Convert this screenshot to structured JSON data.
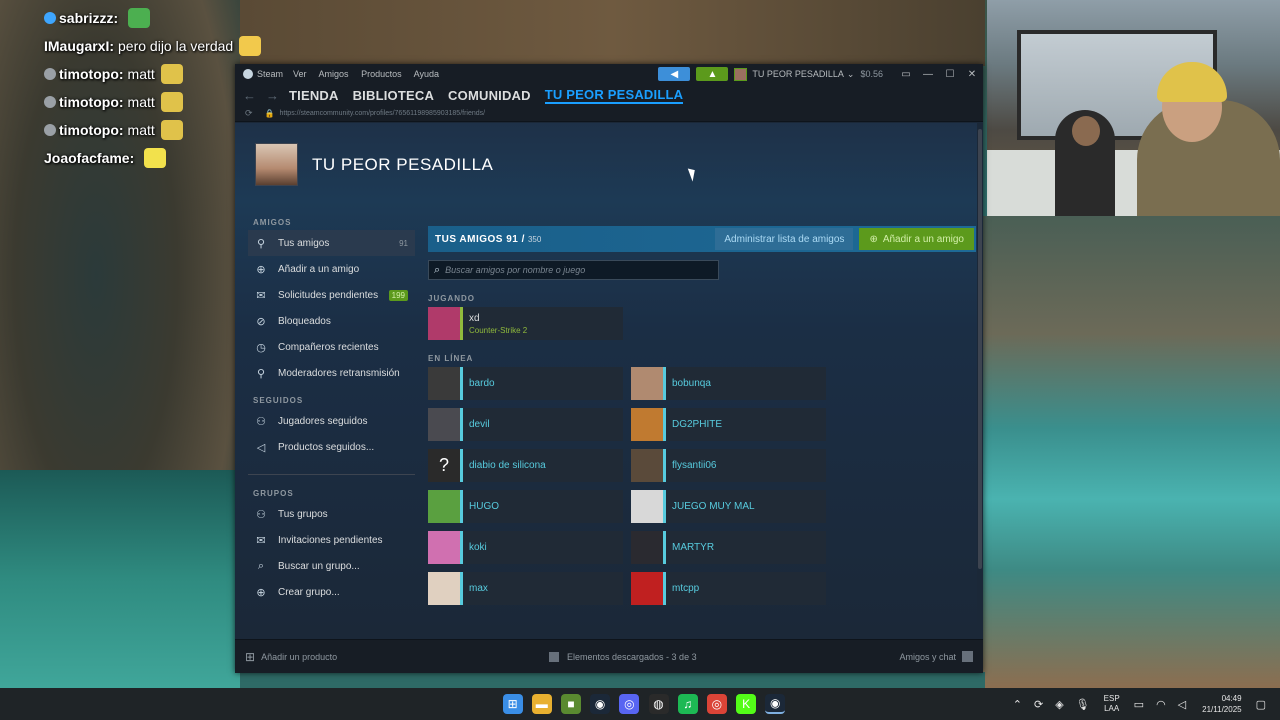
{
  "chat": [
    {
      "name": "sabrizzz:",
      "msg": "",
      "badge_color": "#3ea6ff",
      "emote_color": "#4caf50"
    },
    {
      "name": "IMaugarxI:",
      "msg": "pero dijo la verdad",
      "badge_color": "",
      "emote_color": "#f2c94c"
    },
    {
      "name": "timotopo:",
      "msg": "matt",
      "badge_color": "#9aa0a6",
      "emote_color": "#e0c24a"
    },
    {
      "name": "timotopo:",
      "msg": "matt",
      "badge_color": "#9aa0a6",
      "emote_color": "#e0c24a"
    },
    {
      "name": "timotopo:",
      "msg": "matt",
      "badge_color": "#9aa0a6",
      "emote_color": "#e0c24a"
    },
    {
      "name": "Joaofacfame:",
      "msg": "",
      "badge_color": "",
      "emote_color": "#f2e14c"
    }
  ],
  "titlebar": {
    "app": "Steam",
    "menu": [
      "Ver",
      "Amigos",
      "Productos",
      "Ayuda"
    ],
    "user": "TU PEOR PESADILLA",
    "balance": "$0.56"
  },
  "nav": {
    "items": [
      "TIENDA",
      "BIBLIOTECA",
      "COMUNIDAD",
      "TU PEOR PESADILLA"
    ],
    "active_index": 3
  },
  "url": "https://steamcommunity.com/profiles/76561198985903185/friends/",
  "profile": {
    "name": "TU PEOR PESADILLA"
  },
  "sidebar": {
    "sections": [
      {
        "title": "AMIGOS",
        "items": [
          {
            "label": "Tus amigos",
            "icon": "person-icon",
            "count": "91",
            "active": true
          },
          {
            "label": "Añadir a un amigo",
            "icon": "add-person-icon",
            "count": ""
          },
          {
            "label": "Solicitudes pendientes",
            "icon": "mail-icon",
            "count": "199",
            "count_green": true
          },
          {
            "label": "Bloqueados",
            "icon": "block-icon",
            "count": ""
          },
          {
            "label": "Compañeros recientes",
            "icon": "clock-icon",
            "count": ""
          },
          {
            "label": "Moderadores retransmisión",
            "icon": "person-icon",
            "count": ""
          }
        ]
      },
      {
        "title": "SEGUIDOS",
        "items": [
          {
            "label": "Jugadores seguidos",
            "icon": "people-icon",
            "count": ""
          },
          {
            "label": "Productos seguidos...",
            "icon": "megaphone-icon",
            "count": ""
          }
        ]
      },
      {
        "title": "GRUPOS",
        "items": [
          {
            "label": "Tus grupos",
            "icon": "people-icon",
            "count": ""
          },
          {
            "label": "Invitaciones pendientes",
            "icon": "mail-icon",
            "count": ""
          },
          {
            "label": "Buscar un grupo...",
            "icon": "search-icon",
            "count": ""
          },
          {
            "label": "Crear grupo...",
            "icon": "plus-circle-icon",
            "count": ""
          }
        ]
      }
    ]
  },
  "friends": {
    "header_title": "TUS AMIGOS",
    "count": "91",
    "separator": "/",
    "max": "350",
    "manage_label": "Administrar lista de amigos",
    "add_label": "Añadir a un amigo",
    "search_placeholder": "Buscar amigos por nombre o juego",
    "playing_label": "JUGANDO",
    "playing": [
      {
        "name": "xd",
        "game": "Counter-Strike 2",
        "color": "#b03a6a"
      }
    ],
    "online_label": "EN LÍNEA",
    "online": [
      {
        "name": "bardo",
        "color": "#3a3a3a"
      },
      {
        "name": "bobunqa",
        "color": "#b08a70"
      },
      {
        "name": "devil",
        "color": "#4a4a50"
      },
      {
        "name": "DG2PHITE",
        "color": "#c07a30"
      },
      {
        "name": "diabio de silicona",
        "color": "#2a2a2a",
        "unknown": true
      },
      {
        "name": "flysantii06",
        "color": "#5a4a3a"
      },
      {
        "name": "HUGO",
        "color": "#5aa040"
      },
      {
        "name": "JUEGO MUY MAL",
        "color": "#d8d8d8"
      },
      {
        "name": "koki",
        "color": "#d070b0"
      },
      {
        "name": "MARTYR",
        "color": "#2a2a30"
      },
      {
        "name": "max",
        "color": "#e0d0c0"
      },
      {
        "name": "mtcpp",
        "color": "#c02020"
      }
    ]
  },
  "bottombar": {
    "add_product": "Añadir un producto",
    "downloads": "Elementos descargados - 3 de 3",
    "friends_chat": "Amigos y chat"
  },
  "taskbar": {
    "apps": [
      {
        "name": "windows-start-icon",
        "color": "#3a8ee6",
        "glyph": "⊞"
      },
      {
        "name": "file-explorer-icon",
        "color": "#e8b030",
        "glyph": "▬"
      },
      {
        "name": "minecraft-icon",
        "color": "#5a8a30",
        "glyph": "■"
      },
      {
        "name": "steam-icon",
        "color": "#1b2838",
        "glyph": "◉"
      },
      {
        "name": "discord-icon",
        "color": "#5865f2",
        "glyph": "◎"
      },
      {
        "name": "obs-icon",
        "color": "#2a2a2a",
        "glyph": "◍"
      },
      {
        "name": "spotify-icon",
        "color": "#1db954",
        "glyph": "♫"
      },
      {
        "name": "chrome-icon",
        "color": "#db4437",
        "glyph": "◎"
      },
      {
        "name": "kick-icon",
        "color": "#53fc18",
        "glyph": "K"
      },
      {
        "name": "steam-active-icon",
        "color": "#1b2838",
        "glyph": "◉",
        "active": true
      }
    ],
    "lang_top": "ESP",
    "lang_bottom": "LAA",
    "time": "04:49",
    "date": "21/11/2025"
  }
}
